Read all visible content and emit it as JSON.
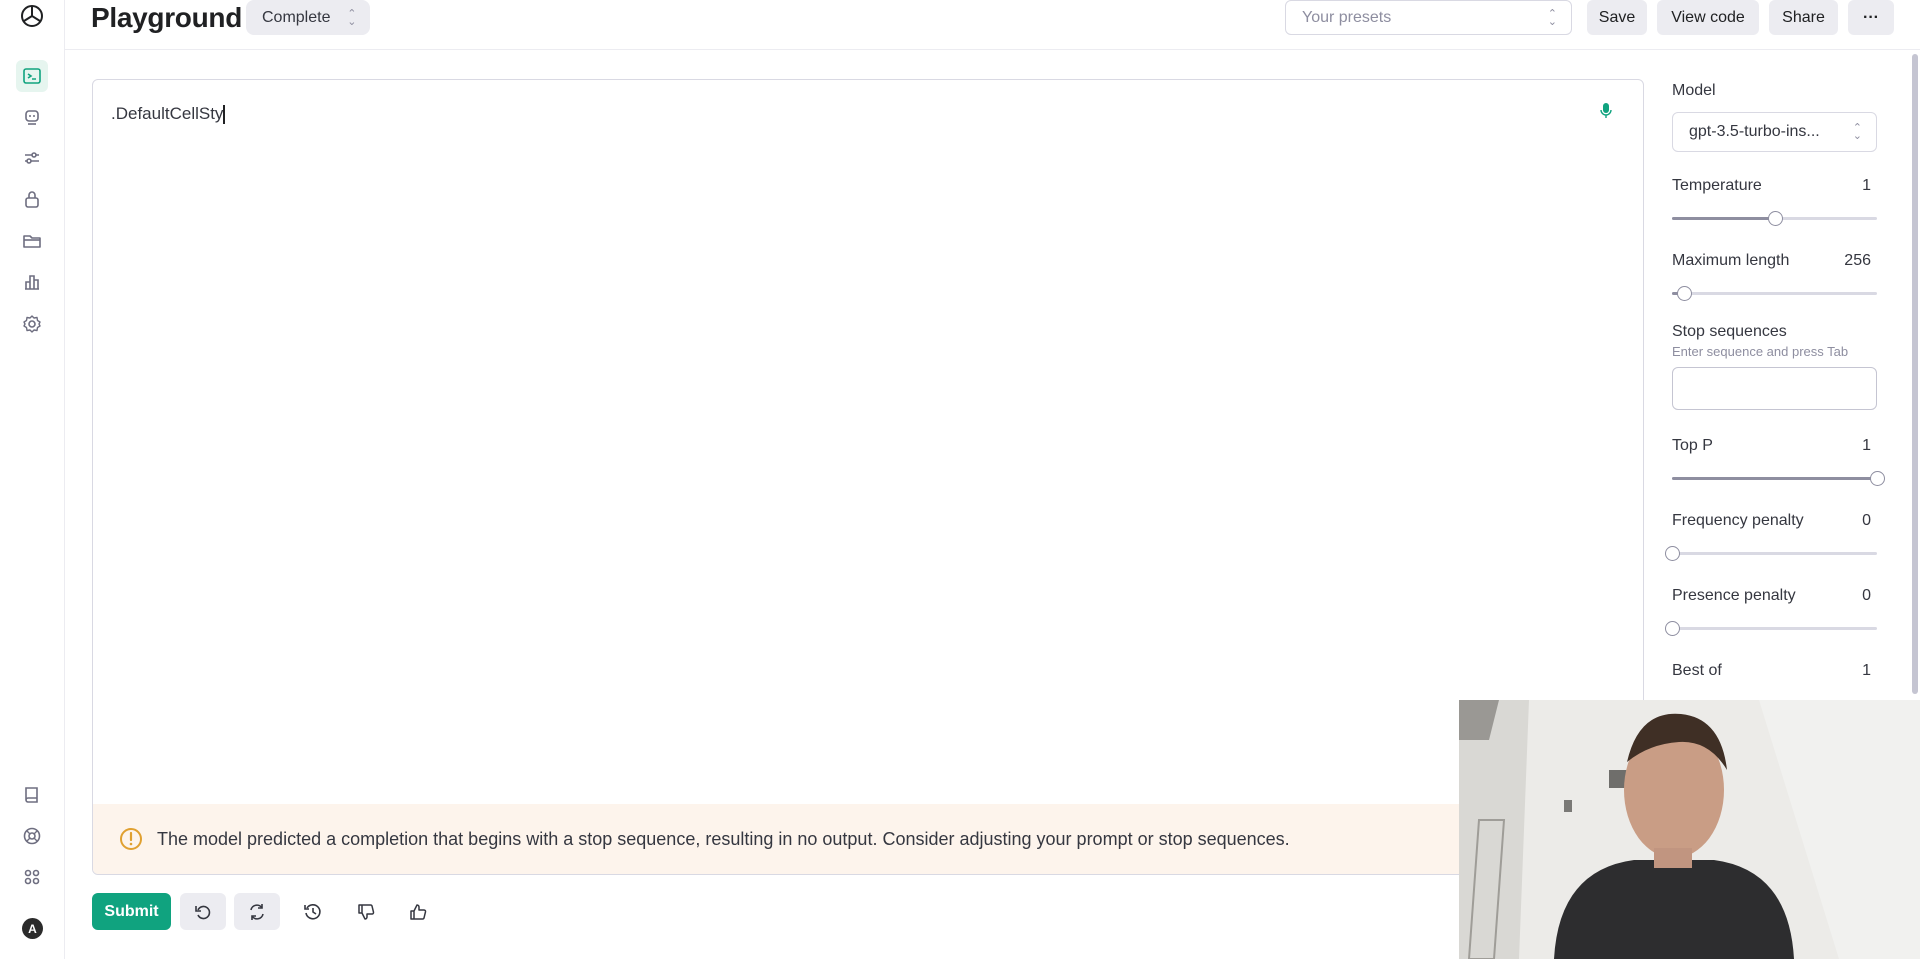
{
  "header": {
    "title": "Playground",
    "mode": "Complete",
    "presets_placeholder": "Your presets",
    "save_label": "Save",
    "view_code_label": "View code",
    "share_label": "Share",
    "more_label": "···"
  },
  "rail": {
    "items": [
      "terminal-icon",
      "assistant-icon",
      "sliders-icon",
      "lock-icon",
      "folder-icon",
      "usage-icon",
      "settings-icon"
    ],
    "bottom_items": [
      "docs-icon",
      "help-icon",
      "apps-icon"
    ],
    "avatar_letter": "A",
    "accent": "#10a37f"
  },
  "editor": {
    "text": ".DefaultCellSty",
    "warning": "The model predicted a completion that begins with a stop sequence, resulting in no output. Consider adjusting your prompt or stop sequences."
  },
  "toolbar": {
    "submit_label": "Submit"
  },
  "panel": {
    "model_label": "Model",
    "model_value": "gpt-3.5-turbo-ins...",
    "temperature_label": "Temperature",
    "temperature_value": "1",
    "temperature_fraction": 0.5,
    "max_length_label": "Maximum length",
    "max_length_value": "256",
    "max_length_fraction": 0.06,
    "stop_label": "Stop sequences",
    "stop_hint": "Enter sequence and press Tab",
    "top_p_label": "Top P",
    "top_p_value": "1",
    "top_p_fraction": 1.0,
    "freq_label": "Frequency penalty",
    "freq_value": "0",
    "freq_fraction": 0.0,
    "presence_label": "Presence penalty",
    "presence_value": "0",
    "presence_fraction": 0.0,
    "best_of_label": "Best of",
    "best_of_value": "1"
  },
  "colors": {
    "accent": "#10a37f",
    "warning_bg": "#fdf4ec",
    "warning_icon": "#e0a030"
  }
}
